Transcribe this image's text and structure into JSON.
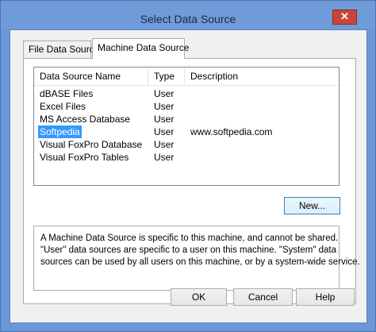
{
  "window": {
    "title": "Select Data Source",
    "close_glyph": "✕"
  },
  "tabs": [
    {
      "label": "File Data Source"
    },
    {
      "label": "Machine Data Source"
    }
  ],
  "list": {
    "columns": [
      "Data Source Name",
      "Type",
      "Description"
    ],
    "rows": [
      {
        "name": "dBASE Files",
        "type": "User",
        "description": ""
      },
      {
        "name": "Excel Files",
        "type": "User",
        "description": ""
      },
      {
        "name": "MS Access Database",
        "type": "User",
        "description": ""
      },
      {
        "name": "Softpedia",
        "type": "User",
        "description": "www.softpedia.com"
      },
      {
        "name": "Visual FoxPro Database",
        "type": "User",
        "description": ""
      },
      {
        "name": "Visual FoxPro Tables",
        "type": "User",
        "description": ""
      }
    ],
    "selected_index": 3
  },
  "buttons": {
    "new": "New...",
    "ok": "OK",
    "cancel": "Cancel",
    "help": "Help"
  },
  "info": {
    "lines": [
      "A Machine Data Source is specific to this machine, and cannot be shared.",
      "\"User\" data sources are specific to a user on this machine.  \"System\" data",
      "sources can be used by all users on this machine, or by a system-wide service."
    ]
  },
  "colors": {
    "titlebar": "#6f9bd9",
    "selection": "#3399ff",
    "close_button": "#c7463c"
  }
}
